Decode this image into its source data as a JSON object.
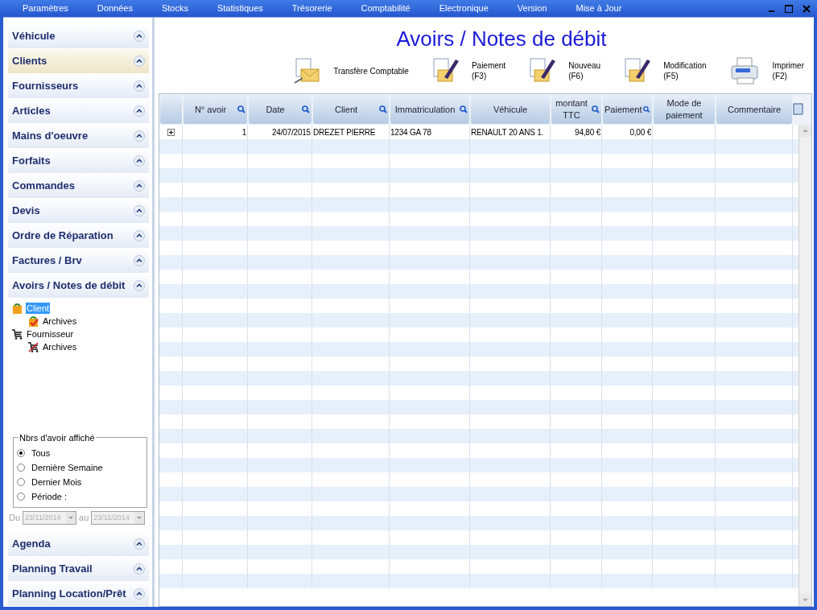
{
  "menu": [
    "Paramètres",
    "Données",
    "Stocks",
    "Statistiques",
    "Trésorerie",
    "Comptabilité",
    "Electronique",
    "Version",
    "Mise à Jour"
  ],
  "sidebar_top": [
    {
      "label": "Véhicule",
      "selected": false
    },
    {
      "label": "Clients",
      "selected": true
    },
    {
      "label": "Fournisseurs",
      "selected": false
    },
    {
      "label": "Articles",
      "selected": false
    },
    {
      "label": "Mains d'oeuvre",
      "selected": false
    },
    {
      "label": "Forfaits",
      "selected": false
    },
    {
      "label": "Commandes",
      "selected": false
    },
    {
      "label": "Devis",
      "selected": false
    },
    {
      "label": "Ordre de Réparation",
      "selected": false
    },
    {
      "label": "Factures / Brv",
      "selected": false
    },
    {
      "label": "Avoirs / Notes de débit",
      "selected": false
    }
  ],
  "tree": [
    {
      "label": "Client",
      "kind": "bag",
      "selected": true,
      "children": [
        {
          "label": "Archives",
          "kind": "bag-archive",
          "selected": false
        }
      ]
    },
    {
      "label": "Fournisseur",
      "kind": "cart",
      "selected": false,
      "children": [
        {
          "label": "Archives",
          "kind": "cart-archive",
          "selected": false
        }
      ]
    }
  ],
  "filter": {
    "title": "Nbrs d'avoir affiché",
    "options": [
      {
        "label": "Tous",
        "selected": true
      },
      {
        "label": "Dernière Semaine",
        "selected": false
      },
      {
        "label": "Dernier Mois",
        "selected": false
      },
      {
        "label": "Période :",
        "selected": false
      }
    ],
    "from_label": "Du",
    "from": "23/11/2014",
    "to_label": "au",
    "to": "23/11/2014",
    "disabled": true
  },
  "sidebar_bottom": [
    {
      "label": "Agenda",
      "selected": false
    },
    {
      "label": "Planning Travail",
      "selected": false
    },
    {
      "label": "Planning Location/Prêt",
      "selected": false
    }
  ],
  "title": "Avoirs / Notes de débit",
  "toolbar": [
    {
      "kind": "transfer",
      "label": "Transfère Comptable"
    },
    {
      "kind": "edit",
      "label": "Paiement",
      "key": "(F3)"
    },
    {
      "kind": "edit",
      "label": "Nouveau",
      "key": "(F6)"
    },
    {
      "kind": "edit",
      "label": "Modification",
      "key": "(F5)"
    },
    {
      "kind": "print",
      "label": "Imprimer",
      "key": "(F2)"
    }
  ],
  "table": {
    "columns": [
      {
        "label": "N° avoir",
        "search": true
      },
      {
        "label": "Date",
        "search": true
      },
      {
        "label": "Client",
        "search": true
      },
      {
        "label": "Immatriculation",
        "search": true
      },
      {
        "label": "Véhicule",
        "search": false
      },
      {
        "label": "montant TTC",
        "search": true
      },
      {
        "label": "Paiement",
        "search": true
      },
      {
        "label": "Mode de paiement",
        "search": false
      },
      {
        "label": "Commentaire",
        "search": false
      }
    ],
    "rows": [
      [
        "1",
        "24/07/2015",
        "DREZET PIERRE",
        "1234 GA 78",
        "RENAULT 20 ANS 1.",
        "94,80 €",
        "0,00 €",
        "",
        ""
      ]
    ]
  }
}
